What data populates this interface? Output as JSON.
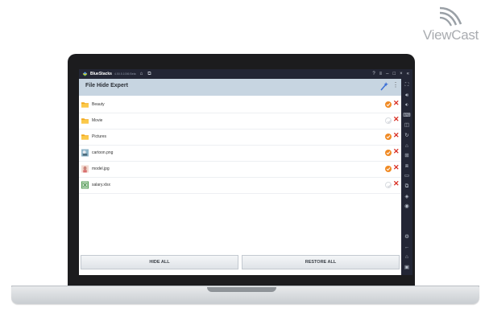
{
  "brand": {
    "name": "ViewCast"
  },
  "bluestacks": {
    "title": "BlueStacks",
    "version": "4.50.5.1006 Beta",
    "right_icons": [
      "help-icon",
      "menu-icon",
      "minimize-icon",
      "maximize-icon",
      "close-icon",
      "collapse-icon"
    ],
    "side_icons": [
      "expand-icon",
      "volume-up-icon",
      "volume-down-icon",
      "keymap-icon",
      "screenshot-icon",
      "rotate-icon",
      "shake-icon",
      "gamepad-icon",
      "screenrecord-icon",
      "folder-icon",
      "copy-icon",
      "layers-icon",
      "location-icon",
      "settings-icon",
      "back-icon",
      "home-icon",
      "recents-icon"
    ]
  },
  "app": {
    "title": "File Hide Expert",
    "files": [
      {
        "name": "Beauty",
        "type": "folder",
        "hidden": true
      },
      {
        "name": "Movie",
        "type": "folder",
        "hidden": false
      },
      {
        "name": "Pictures",
        "type": "folder",
        "hidden": true
      },
      {
        "name": "cartoon.png",
        "type": "image",
        "hidden": true
      },
      {
        "name": "model.jpg",
        "type": "photo",
        "hidden": true
      },
      {
        "name": "salary.xlsx",
        "type": "spreadsheet",
        "hidden": false
      }
    ],
    "buttons": {
      "hide_all": "HIDE ALL",
      "restore_all": "RESTORE ALL"
    }
  },
  "colors": {
    "appbar": "#c7d5e1",
    "status_on": "#f08a24",
    "delete": "#d82c20",
    "emulator_chrome": "#232635"
  }
}
